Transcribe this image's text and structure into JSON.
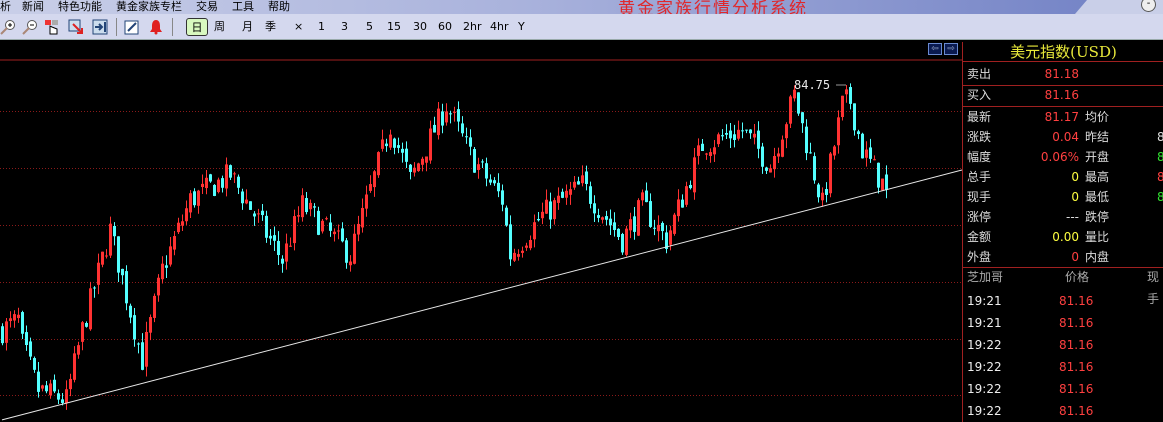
{
  "menu": {
    "items": [
      "析",
      "新闻",
      "特色功能",
      "黄金家族专栏",
      "交易",
      "工具",
      "帮助"
    ],
    "app_title": "黄金家族行情分析系统",
    "minimize": "-"
  },
  "toolbar": {
    "periods": [
      "日",
      "周",
      "月",
      "季",
      "×",
      "1",
      "3",
      "5",
      "15",
      "30",
      "60",
      "2hr",
      "4hr",
      "Y"
    ],
    "active": "日"
  },
  "panel": {
    "title": "美元指数(USD)",
    "ask": {
      "label": "卖出",
      "value": "81.18"
    },
    "bid": {
      "label": "买入",
      "value": "81.16"
    },
    "rows": [
      {
        "l": "最新",
        "v": "81.17",
        "l2": "均价",
        "v2": ""
      },
      {
        "l": "涨跌",
        "v": "0.04",
        "l2": "昨结",
        "v2": "8"
      },
      {
        "l": "幅度",
        "v": "0.06%",
        "l2": "开盘",
        "v2": "8"
      },
      {
        "l": "总手",
        "v": "0",
        "l2": "最高",
        "v2": "8"
      },
      {
        "l": "现手",
        "v": "0",
        "l2": "最低",
        "v2": "8"
      },
      {
        "l": "涨停",
        "v": "---",
        "l2": "跌停",
        "v2": ""
      },
      {
        "l": "金额",
        "v": "0.00",
        "l2": "量比",
        "v2": ""
      },
      {
        "l": "外盘",
        "v": "0",
        "l2": "内盘",
        "v2": ""
      }
    ],
    "ticks_header": [
      "芝加哥",
      "价格",
      "现手"
    ],
    "ticks": [
      {
        "time": "19:21",
        "price": "81.16"
      },
      {
        "time": "19:21",
        "price": "81.16"
      },
      {
        "time": "19:22",
        "price": "81.16"
      },
      {
        "time": "19:22",
        "price": "81.16"
      },
      {
        "time": "19:22",
        "price": "81.16"
      },
      {
        "time": "19:22",
        "price": "81.16"
      }
    ]
  },
  "colors": {
    "up": "#ff3232",
    "down": "#54ffff",
    "grid": "#8a1a1a",
    "trend": "#e8e8e8"
  },
  "chart_data": {
    "type": "candlestick",
    "title": "美元指数(USD)",
    "candle_count": 222,
    "price_range": [
      72.3,
      85.7
    ],
    "grid_levels": [
      85.37,
      83.87,
      81.92,
      79.98,
      78.03,
      76.09,
      74.18
    ],
    "path_keypoints": [
      [
        0,
        76.39
      ],
      [
        4,
        76.73
      ],
      [
        5,
        75.88
      ],
      [
        9,
        74.34
      ],
      [
        16,
        74.0
      ],
      [
        20,
        76.39
      ],
      [
        27,
        79.8
      ],
      [
        35,
        75.36
      ],
      [
        40,
        78.44
      ],
      [
        47,
        80.83
      ],
      [
        57,
        81.68
      ],
      [
        70,
        78.78
      ],
      [
        75,
        80.65
      ],
      [
        87,
        78.95
      ],
      [
        97,
        83.38
      ],
      [
        102,
        81.51
      ],
      [
        111,
        84.07
      ],
      [
        117,
        82.36
      ],
      [
        125,
        80.83
      ],
      [
        127,
        78.95
      ],
      [
        135,
        80.31
      ],
      [
        145,
        81.34
      ],
      [
        155,
        79.46
      ],
      [
        160,
        80.65
      ],
      [
        166,
        79.46
      ],
      [
        175,
        82.7
      ],
      [
        185,
        83.21
      ],
      [
        192,
        82.02
      ],
      [
        198,
        84.41
      ],
      [
        205,
        80.65
      ],
      [
        211,
        84.75
      ],
      [
        215,
        82.53
      ],
      [
        221,
        81.17
      ]
    ],
    "high_label": "84.75",
    "trendline": [
      [
        0,
        73.32
      ],
      [
        240,
        81.85
      ]
    ]
  }
}
